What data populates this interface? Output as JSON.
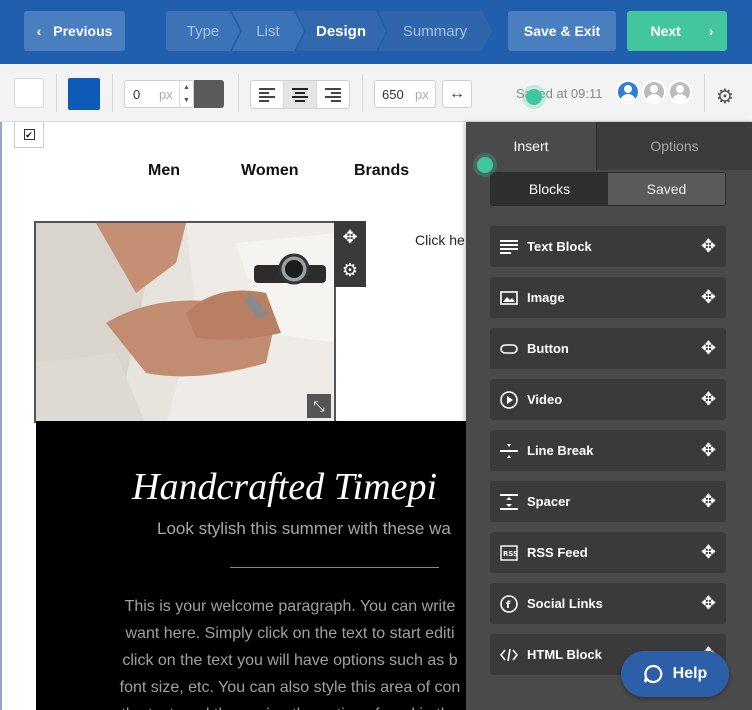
{
  "topbar": {
    "previous_label": "Previous",
    "steps": [
      "Type",
      "List",
      "Design",
      "Summary"
    ],
    "save_exit_label": "Save & Exit",
    "next_label": "Next"
  },
  "toolbar": {
    "border_width_value": "0",
    "border_width_unit": "px",
    "content_width_value": "650",
    "content_width_unit": "px",
    "saved_status": "Saved at 09:11",
    "background_color": "#ffffff",
    "accent_color": "#0e5bb7",
    "border_color": "#5a5a5a",
    "icons": {
      "align_left": "align-left-icon",
      "align_center": "align-center-icon",
      "align_right": "align-right-icon",
      "expand": "expand-width-icon",
      "settings": "gear-icon"
    }
  },
  "canvas": {
    "nav_links": [
      "Men",
      "Women",
      "Brands"
    ],
    "click_here": "Click he",
    "hero_title": "Handcrafted Timepi",
    "hero_subtitle": "Look stylish this summer with these wa",
    "paragraph_lines": [
      "This is your welcome paragraph. You can write",
      "want here. Simply click on the text to start editi",
      "click on the text you will have options such as b",
      "font size, etc. You can also style this area of con",
      "the text, and then using the options found in the"
    ]
  },
  "panel": {
    "tabs": [
      "Insert",
      "Options"
    ],
    "segments": [
      "Blocks",
      "Saved"
    ],
    "blocks": [
      {
        "label": "Text Block",
        "icon": "text-lines-icon"
      },
      {
        "label": "Image",
        "icon": "image-icon"
      },
      {
        "label": "Button",
        "icon": "button-icon"
      },
      {
        "label": "Video",
        "icon": "play-icon"
      },
      {
        "label": "Line Break",
        "icon": "line-break-icon"
      },
      {
        "label": "Spacer",
        "icon": "spacer-icon"
      },
      {
        "label": "RSS Feed",
        "icon": "rss-icon"
      },
      {
        "label": "Social Links",
        "icon": "facebook-icon"
      },
      {
        "label": "HTML Block",
        "icon": "code-icon"
      }
    ]
  },
  "help_label": "Help"
}
